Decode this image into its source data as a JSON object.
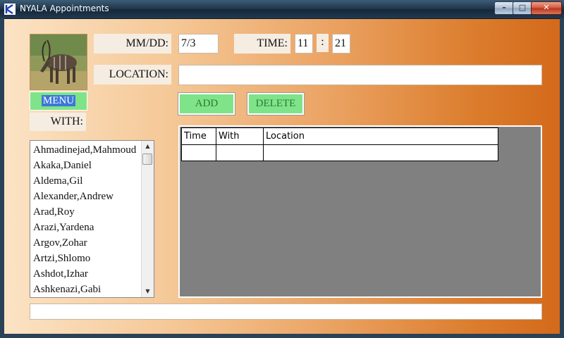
{
  "window": {
    "title": "NYALA Appointments",
    "minimize_icon": "minimize-icon",
    "maximize_icon": "maximize-icon",
    "close_icon": "close-icon"
  },
  "photo": {
    "icon": "nyala-antelope-photo"
  },
  "menu": {
    "label": "MENU"
  },
  "date": {
    "label": "MM/DD:",
    "value": "7/3"
  },
  "time": {
    "label": "TIME:",
    "hour": "11",
    "separator": ":",
    "minute": "21"
  },
  "location": {
    "label": "LOCATION:",
    "value": ""
  },
  "buttons": {
    "add": "ADD",
    "delete": "DELETE"
  },
  "with": {
    "label": "WITH:"
  },
  "contacts": [
    "Ahmadinejad,Mahmoud",
    "Akaka,Daniel",
    "Aldema,Gil",
    "Alexander,Andrew",
    "Arad,Roy",
    "Arazi,Yardena",
    "Argov,Zohar",
    "Artzi,Shlomo",
    "Ashdot,Izhar",
    "Ashkenazi,Gabi"
  ],
  "appointments": {
    "columns": [
      "Time",
      "With",
      "Location"
    ],
    "rows": [
      [
        "",
        "",
        ""
      ]
    ]
  },
  "status": {
    "text": ""
  },
  "colors": {
    "button_green": "#7fe38a",
    "button_text": "#2a7a32",
    "menu_highlight": "#3b78d8",
    "grid_background": "#808080"
  }
}
